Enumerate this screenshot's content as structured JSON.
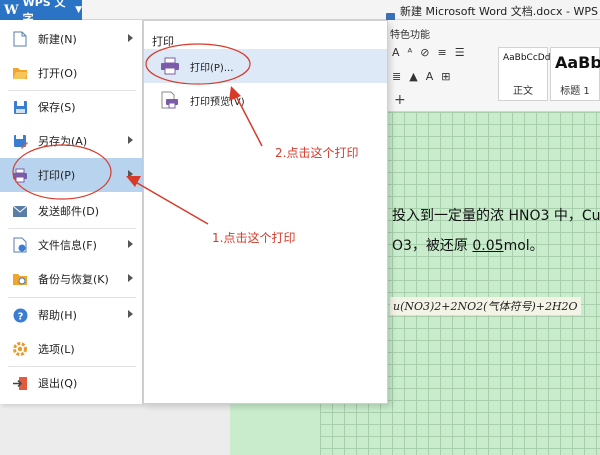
{
  "titlebar": {
    "app_name": "WPS 文字",
    "app_logo": "W",
    "doc_title": "新建 Microsoft Word 文档.docx - WPS 文字"
  },
  "ribbon": {
    "tab_label": "特色功能",
    "styles": [
      {
        "sample": "AaBbCcDd",
        "name": "正文"
      },
      {
        "sample": "AaBb",
        "name": "标题 1"
      }
    ],
    "plus": "+"
  },
  "menu": {
    "items": [
      {
        "label": "新建(N)",
        "icon": "new-doc-icon",
        "arrow": true
      },
      {
        "label": "打开(O)",
        "icon": "folder-open-icon",
        "arrow": false
      },
      {
        "label": "保存(S)",
        "icon": "save-icon",
        "arrow": false
      },
      {
        "label": "另存为(A)",
        "icon": "save-as-icon",
        "arrow": true
      },
      {
        "label": "打印(P)",
        "icon": "printer-icon",
        "arrow": true,
        "active": true
      },
      {
        "label": "发送邮件(D)",
        "icon": "mail-icon",
        "arrow": false
      },
      {
        "label": "文件信息(F)",
        "icon": "file-info-icon",
        "arrow": true
      },
      {
        "label": "备份与恢复(K)",
        "icon": "backup-icon",
        "arrow": true
      },
      {
        "label": "帮助(H)",
        "icon": "help-icon",
        "arrow": true
      },
      {
        "label": "选项(L)",
        "icon": "gear-icon",
        "arrow": false
      },
      {
        "label": "退出(Q)",
        "icon": "exit-icon",
        "arrow": false
      }
    ]
  },
  "submenu": {
    "header": "打印",
    "items": [
      {
        "label": "打印(P)...",
        "icon": "printer-icon"
      },
      {
        "label": "打印预览(V)",
        "icon": "print-preview-icon"
      }
    ]
  },
  "document": {
    "line1": "投入到一定量的浓 HNO3 中，Cu",
    "line2_prefix": "O3，被还原 ",
    "line2_value": "0.05",
    "line2_suffix": "mol。",
    "formula": "u(NO3)2+2NO2(气体符号)+2H2O"
  },
  "annotations": {
    "step1": "1.点击这个打印",
    "step2": "2.点击这个打印",
    "color": "#d83a2a"
  }
}
